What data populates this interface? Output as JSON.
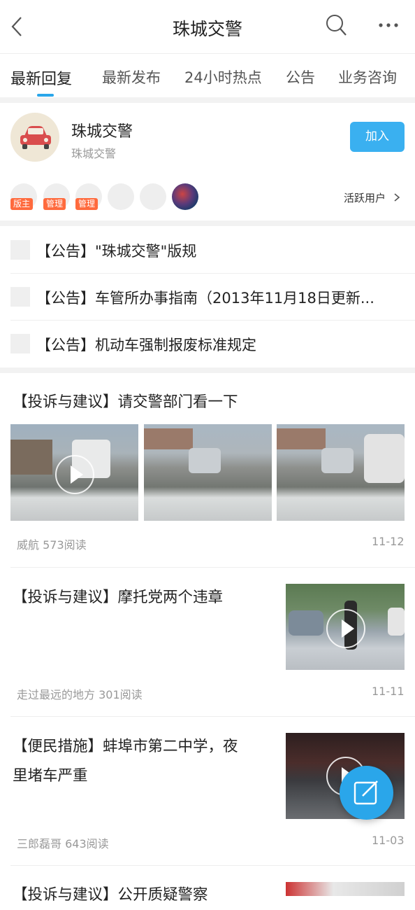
{
  "header": {
    "title": "珠城交警",
    "back_icon": "back-arrow-icon",
    "search_icon": "search-icon",
    "more_icon": "more-icon"
  },
  "tabs": [
    {
      "label": "最新回复",
      "active": true
    },
    {
      "label": "最新发布"
    },
    {
      "label": "24小时热点"
    },
    {
      "label": "公告"
    },
    {
      "label": "业务咨询"
    }
  ],
  "forum": {
    "name": "珠城交警",
    "subtitle": "珠城交警",
    "join_label": "加入",
    "badges": [
      "版主",
      "管理",
      "管理"
    ],
    "active_users_label": "活跃用户",
    "accent": "#3ab0f0"
  },
  "notices": [
    {
      "text": "【公告】\"珠城交警\"版规"
    },
    {
      "text": "【公告】车管所办事指南（2013年11月18日更新..."
    },
    {
      "text": "【公告】机动车强制报废标准规定"
    }
  ],
  "posts": [
    {
      "title": "【投诉与建议】请交警部门看一下",
      "meta": "威航 573阅读",
      "date": "11-12"
    },
    {
      "title": "【投诉与建议】摩托党两个违章",
      "meta": "走过最远的地方 301阅读",
      "date": "11-11"
    },
    {
      "title_line1": "【便民措施】蚌埠市第二中学，夜",
      "title_line2": "里堵车严重",
      "meta": "三郎磊哥 643阅读",
      "date": "11-03"
    },
    {
      "title": "【投诉与建议】公开质疑警察"
    }
  ],
  "compose_icon": "edit-icon"
}
